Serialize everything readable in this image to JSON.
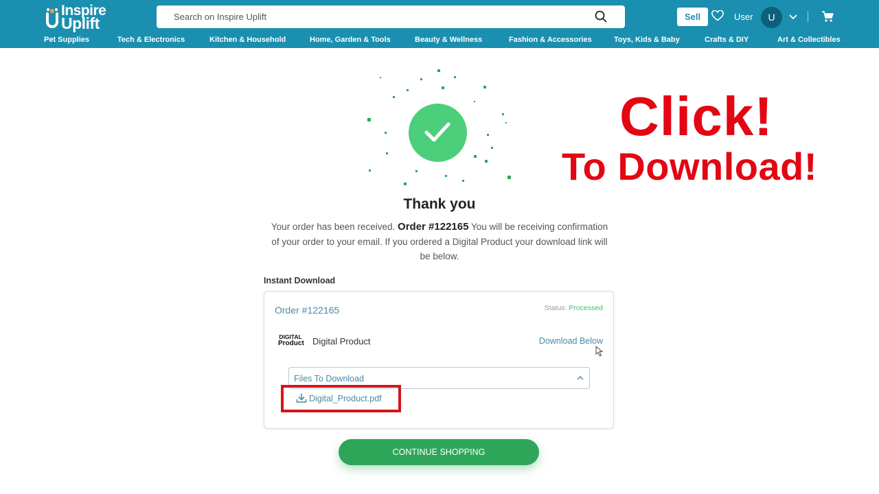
{
  "header": {
    "logo_line1": "Inspire",
    "logo_line2": "Uplift",
    "search_placeholder": "Search on Inspire Uplift",
    "sell_label": "Sell",
    "user_label": "User",
    "avatar_initial": "U",
    "brand_color": "#1b8fb0"
  },
  "categories": [
    "Pet Supplies",
    "Tech & Electronics",
    "Kitchen & Household",
    "Home, Garden & Tools",
    "Beauty & Wellness",
    "Fashion & Accessories",
    "Toys, Kids & Baby",
    "Crafts & DIY",
    "Art & Collectibles"
  ],
  "confirmation": {
    "title": "Thank you",
    "msg_before": "Your order has been received.",
    "order_bold": "Order #122165",
    "msg_after": "You will be receiving confirmation of your order to your email. If you ordered a Digital Product your download link will be below."
  },
  "instant_download": {
    "section_label": "Instant Download",
    "order_number": "Order #122165",
    "status_label": "Status:",
    "status_value": "Processed",
    "product_image_text_1": "DIGITAL",
    "product_image_text_2": "Product",
    "product_name": "Digital Product",
    "download_below": "Download Below",
    "files_header": "Files To Download",
    "file_name": "Digital_Product.pdf"
  },
  "continue_button": "CONTINUE SHOPPING",
  "overlay": {
    "line1": "Click!",
    "line2": "To Download!",
    "color": "#e30613"
  },
  "colors": {
    "accent_green": "#2ea65a",
    "check_green": "#4ccf7b",
    "link_blue": "#4a88a8"
  }
}
